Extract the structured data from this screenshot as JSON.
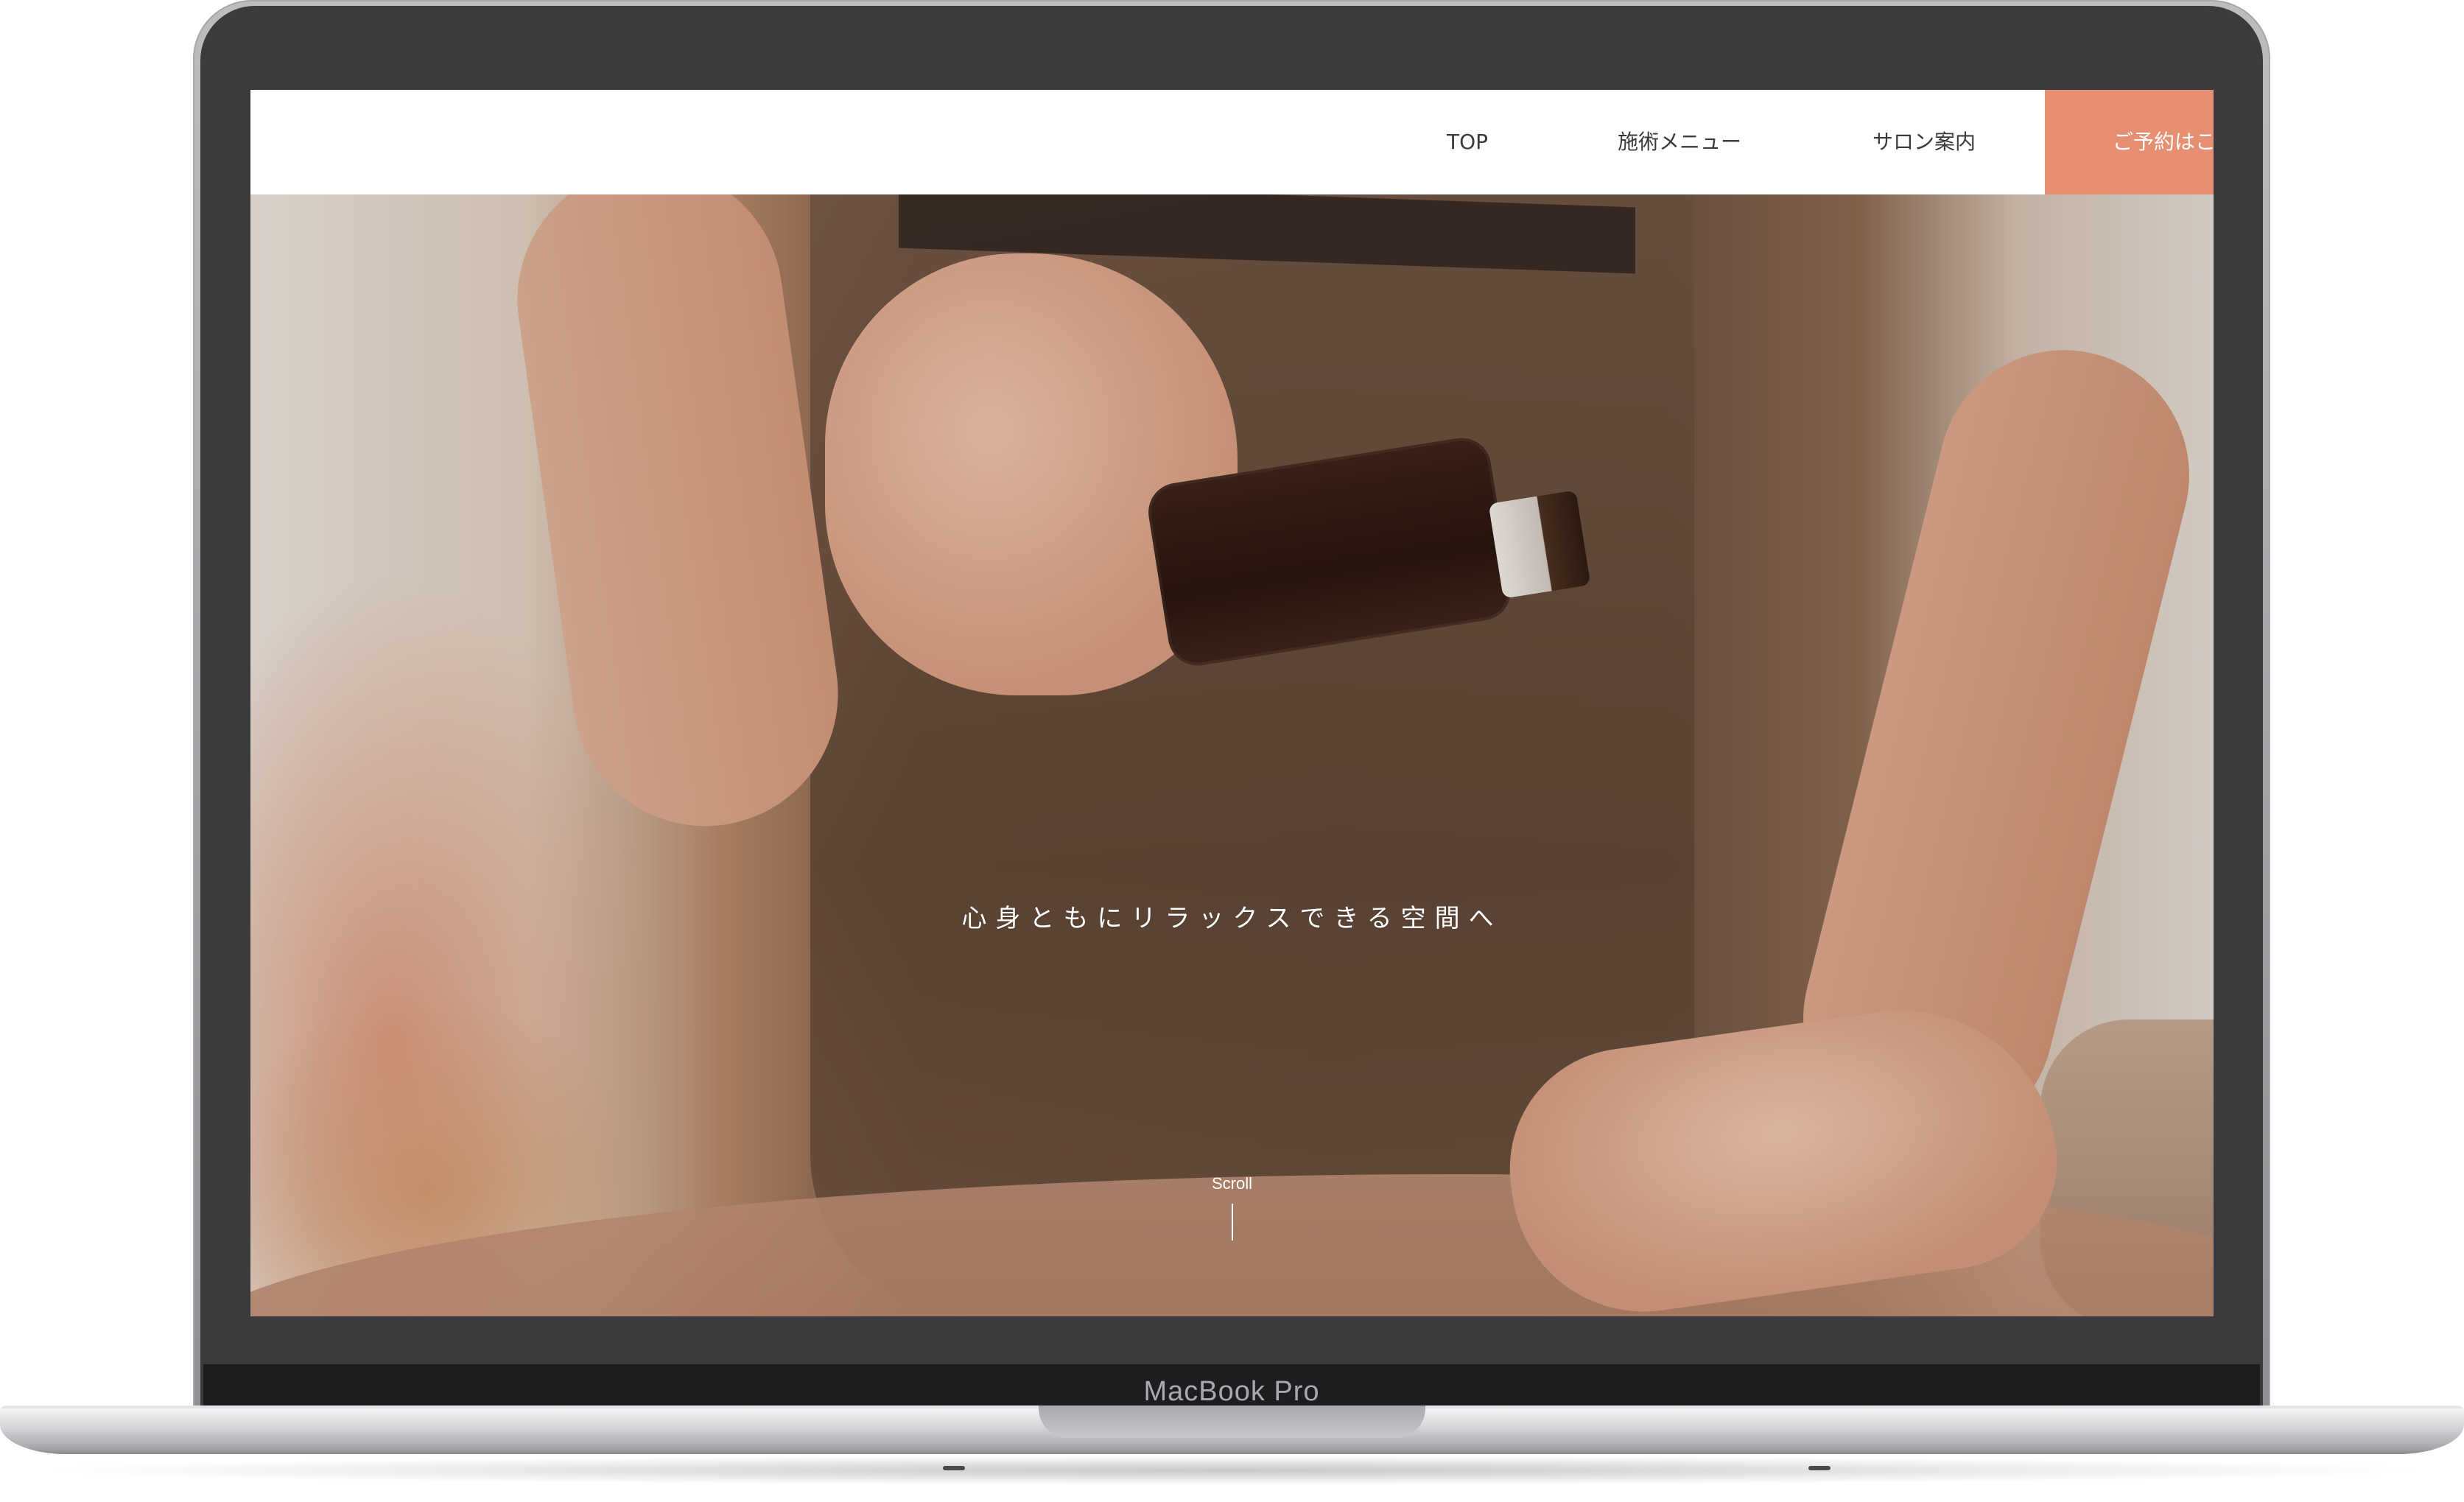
{
  "device": {
    "label": "MacBook Pro"
  },
  "nav": {
    "items": [
      {
        "label": "TOP"
      },
      {
        "label": "施術メニュー"
      },
      {
        "label": "サロン案内"
      }
    ],
    "cta_label": "ご予約はこ",
    "cta_color": "#e78f72"
  },
  "hero": {
    "tagline": "心身ともにリラックスできる空間へ",
    "scroll_label": "Scroll"
  }
}
